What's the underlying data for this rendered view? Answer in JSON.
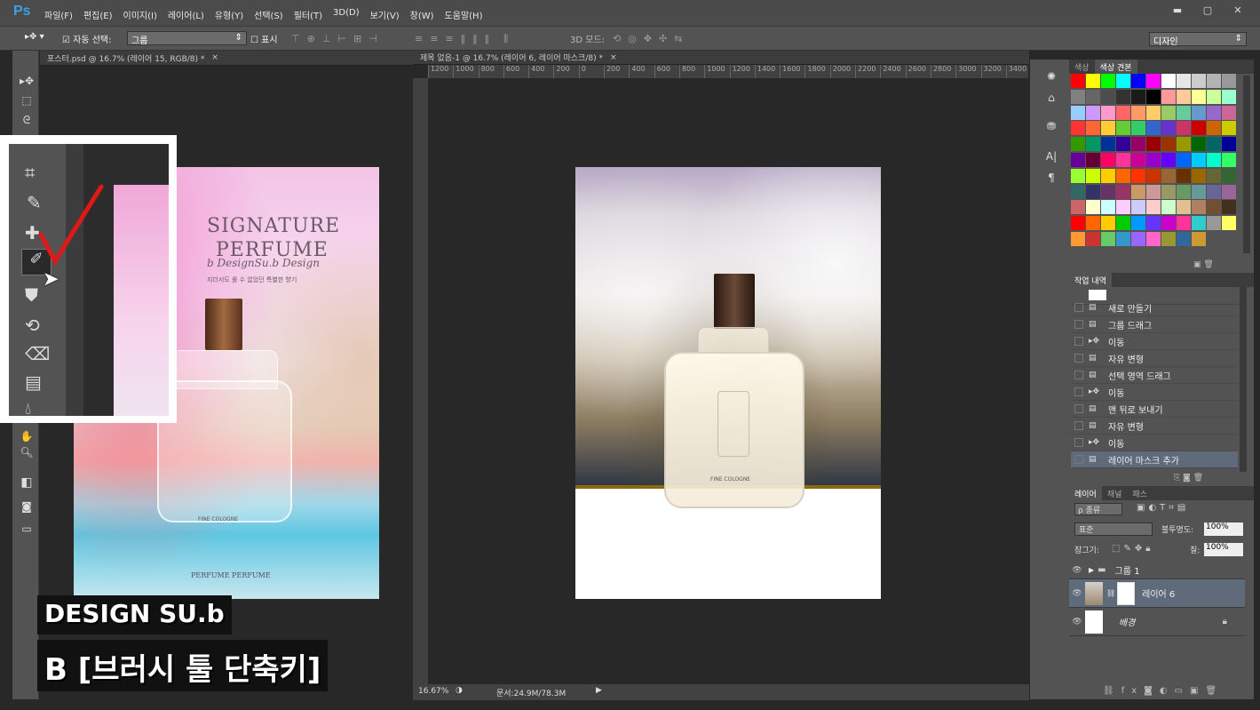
{
  "app": {
    "logo": "Ps"
  },
  "menu": [
    "파일(F)",
    "편집(E)",
    "이미지(I)",
    "레이어(L)",
    "유형(Y)",
    "선택(S)",
    "필터(T)",
    "3D(D)",
    "보기(V)",
    "창(W)",
    "도움말(H)"
  ],
  "options": {
    "auto_select": "자동 선택:",
    "auto_select_value": "그룹",
    "show": "표시",
    "mode3d": "3D 모드:",
    "workspace": "디자인"
  },
  "docs": [
    {
      "tab": "포스터.psd @ 16.7% (레이어 15, RGB/8) *"
    },
    {
      "tab": "제목 없음-1 @ 16.7% (레이어 6, 레이어 마스크/8) *"
    }
  ],
  "ruler_top": [
    "1200",
    "1000",
    "800",
    "600",
    "400",
    "200",
    "0",
    "200",
    "400",
    "600",
    "800",
    "1000",
    "1200",
    "1400",
    "1600",
    "1800",
    "2000",
    "2200",
    "2400",
    "2600",
    "2800",
    "3000",
    "3200",
    "3400",
    "36"
  ],
  "poster": {
    "title1": "SIGNATURE",
    "title2": "PERFUME",
    "script": "b DesignSu.b Design",
    "sub": "지더서도 롤 수 없었던 특별한 향기",
    "bottle_label": "FINE COLOGNE",
    "footer": "PERFUME PERFUME"
  },
  "canvas2": {
    "bottle_label": "FINE COLOGNE"
  },
  "status": {
    "zoom": "16.67%",
    "doc": "문서:24.9M/78.3M"
  },
  "panels": {
    "swatch_tabs": [
      "색상",
      "색상 견본"
    ],
    "history_tab": "작업 내역",
    "history": [
      {
        "label": "새로 만들기",
        "icon": "doc-icon"
      },
      {
        "label": "그룹 드래그",
        "icon": "doc-icon"
      },
      {
        "label": "이동",
        "icon": "move-icon"
      },
      {
        "label": "자유 변형",
        "icon": "doc-icon"
      },
      {
        "label": "선택 영역 드래그",
        "icon": "doc-icon"
      },
      {
        "label": "이동",
        "icon": "move-icon"
      },
      {
        "label": "맨 뒤로 보내기",
        "icon": "doc-icon"
      },
      {
        "label": "자유 변형",
        "icon": "doc-icon"
      },
      {
        "label": "이동",
        "icon": "move-icon"
      },
      {
        "label": "레이어 마스크 추가",
        "icon": "doc-icon"
      }
    ],
    "layer_tabs": [
      "레이어",
      "채널",
      "패스"
    ],
    "filter_kind": "ρ 종류",
    "blend_mode": "표준",
    "opacity_label": "불투명도:",
    "opacity": "100%",
    "lock_label": "잠그기:",
    "fill_label": "칠:",
    "fill": "100%",
    "layers": [
      {
        "name": "그룹 1"
      },
      {
        "name": "레이어 6"
      },
      {
        "name": "배경"
      }
    ]
  },
  "overlay": {
    "brand": "DESIGN SU.b",
    "shortcut": "B [브러시 툴 단축키]"
  },
  "colors": {
    "swatches": [
      "#ff0000",
      "#ffff00",
      "#00ff00",
      "#00ffff",
      "#0000ff",
      "#ff00ff",
      "#ffffff",
      "#e6e6e6",
      "#cccccc",
      "#b3b3b3",
      "#999999",
      "#808080",
      "#666666",
      "#4d4d4d",
      "#333333",
      "#1a1a1a",
      "#000000",
      "#ff9999",
      "#ffcc99",
      "#ffff99",
      "#ccff99",
      "#99ffcc",
      "#99ccff",
      "#cc99ff",
      "#ff99cc",
      "#ff6666",
      "#ff9966",
      "#ffcc66",
      "#99cc66",
      "#66cc99",
      "#6699cc",
      "#9966cc",
      "#cc6699",
      "#ff3333",
      "#ff6633",
      "#ffcc33",
      "#66cc33",
      "#33cc66",
      "#3366cc",
      "#6633cc",
      "#cc3366",
      "#cc0000",
      "#cc6600",
      "#cccc00",
      "#339900",
      "#009966",
      "#003399",
      "#330099",
      "#990066",
      "#990000",
      "#993300",
      "#999900",
      "#006600",
      "#006666",
      "#000099",
      "#660099",
      "#660033",
      "#ff0066",
      "#ff3399",
      "#cc0099",
      "#9900cc",
      "#6600ff",
      "#0066ff",
      "#00ccff",
      "#00ffcc",
      "#33ff66",
      "#99ff33",
      "#ccff00",
      "#ffcc00",
      "#ff6600",
      "#ff3300",
      "#cc3300",
      "#996633",
      "#663300",
      "#996600",
      "#666633",
      "#336633",
      "#336666",
      "#333366",
      "#663366",
      "#993366",
      "#cc9966",
      "#cc9999",
      "#999966",
      "#669966",
      "#669999",
      "#666699",
      "#996699",
      "#cc6666",
      "#ffffcc",
      "#ccffff",
      "#ffccff",
      "#ccccff",
      "#ffcccc",
      "#ccffcc",
      "#e0c090",
      "#b08060",
      "#705030",
      "#403020",
      "#ff0000",
      "#ff6600",
      "#ffcc00",
      "#00cc00",
      "#0099ff",
      "#6633ff",
      "#cc00cc",
      "#ff3399",
      "#33cccc",
      "#999999",
      "#ffff66",
      "#ff9933",
      "#cc3333",
      "#66cc66",
      "#3399cc",
      "#9966ff",
      "#ff66cc",
      "#999933",
      "#336699",
      "#cc9933"
    ]
  }
}
